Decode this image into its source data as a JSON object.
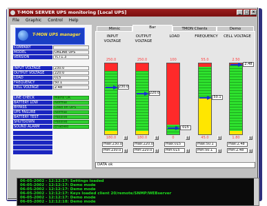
{
  "window": {
    "title": "T-MON SERVER UPS monitoring [Local UPS]"
  },
  "menu": [
    "File",
    "Graphic",
    "Control",
    "Help"
  ],
  "logo": {
    "text": "T-MON UPS manager"
  },
  "info_rows": [
    {
      "label": "COMPANY",
      "value": ""
    },
    {
      "label": "MODEL",
      "value": "ONLINE UPS"
    },
    {
      "label": "VERSION",
      "value": "TCT1.3"
    }
  ],
  "measure_rows": [
    {
      "label": "INPUT VOLTAGE",
      "value": "230.0"
    },
    {
      "label": "OUTPUT VOLTAGE",
      "value": "220.0"
    },
    {
      "label": "LOAD",
      "value": "015"
    },
    {
      "label": "FREQUENCY",
      "value": "50.1"
    },
    {
      "label": "CELL VOLTAGE",
      "value": "2.48"
    }
  ],
  "status_rows": [
    {
      "label": "LINE CHECK",
      "value": "Mains OK"
    },
    {
      "label": "BATTERY LOW",
      "value": "Normal"
    },
    {
      "label": "BYPASS",
      "value": "Load on UPS"
    },
    {
      "label": "UPS FAILURE",
      "value": "Normal"
    },
    {
      "label": "BATTERY TEST",
      "value": "Passive"
    },
    {
      "label": "SHUTDOWN",
      "value": "Passive"
    },
    {
      "label": "SOUND ALARM",
      "value": "Enabled"
    }
  ],
  "tabs": [
    "Mimic",
    "Bar",
    "TMON Clients",
    "Demo"
  ],
  "active_tab": "Bar",
  "gauges": [
    {
      "label1": "INPUT",
      "label2": "VOLTAGE",
      "max_label": "250.0",
      "min_label": "180.0",
      "value": "230.0",
      "level": 0.66,
      "top_color": "#ff2a2a",
      "top_frac": 0.1,
      "bottom_color": "#ffe600",
      "bottom_frac": 0.05,
      "stat_max": "max:230.0",
      "stat_min": "min:230.0"
    },
    {
      "label1": "OUTPUT",
      "label2": "VOLTAGE",
      "max_label": "250.0",
      "min_label": "180.0",
      "value": "220.0",
      "level": 0.57,
      "top_color": "#ff2a2a",
      "top_frac": 0.1,
      "bottom_color": "#ffe600",
      "bottom_frac": 0.05,
      "stat_max": "max:220.0",
      "stat_min": "min:220.0"
    },
    {
      "label1": "LOAD",
      "label2": "",
      "max_label": "100",
      "min_label": "0",
      "value": "015",
      "level": 0.1,
      "top_color": "#ff2a2a",
      "top_frac": 0.85,
      "bottom_color": "#ffe600",
      "bottom_frac": 0.0,
      "stat_max": "max:015",
      "stat_min": "min:015"
    },
    {
      "label1": "FREQUENCY",
      "label2": "",
      "max_label": "55.0",
      "min_label": "45.0",
      "value": "50.1",
      "level": 0.51,
      "top_color": "#ff2a2a",
      "top_frac": 0.05,
      "bottom_color": "#ffe600",
      "bottom_frac": 0.5,
      "stat_max": "max:50.1",
      "stat_min": "min:50.1"
    },
    {
      "label1": "CELL VOLTAGE",
      "label2": "",
      "max_label": "2.50",
      "min_label": "1.80",
      "value": "2.48",
      "level": 0.97,
      "top_color": "#ff2a2a",
      "top_frac": 0.03,
      "bottom_color": "#ffe600",
      "bottom_frac": 0.05,
      "stat_max": "max:2.48",
      "stat_min": "min:2.48"
    }
  ],
  "status_line": "DATA ok",
  "log": [
    "06-05-2002 - 12:12:17: Settings loaded",
    "06-05-2002 - 12:12:17: Demo mode",
    "06-05-2002 - 12:12:17: Demo mode",
    "06-05-2002 - 12:12:17: Keys loaded client 20/remote/SNMP/WEBserver",
    "06-05-2002 - 12:12:17: Demo mode",
    "06-05-2002 - 12:12:18: Demo mode"
  ],
  "colors": {
    "accent_blue": "#1b26c0",
    "ok_green": "#2ecf2e",
    "title_red": "#9a1c1c"
  }
}
